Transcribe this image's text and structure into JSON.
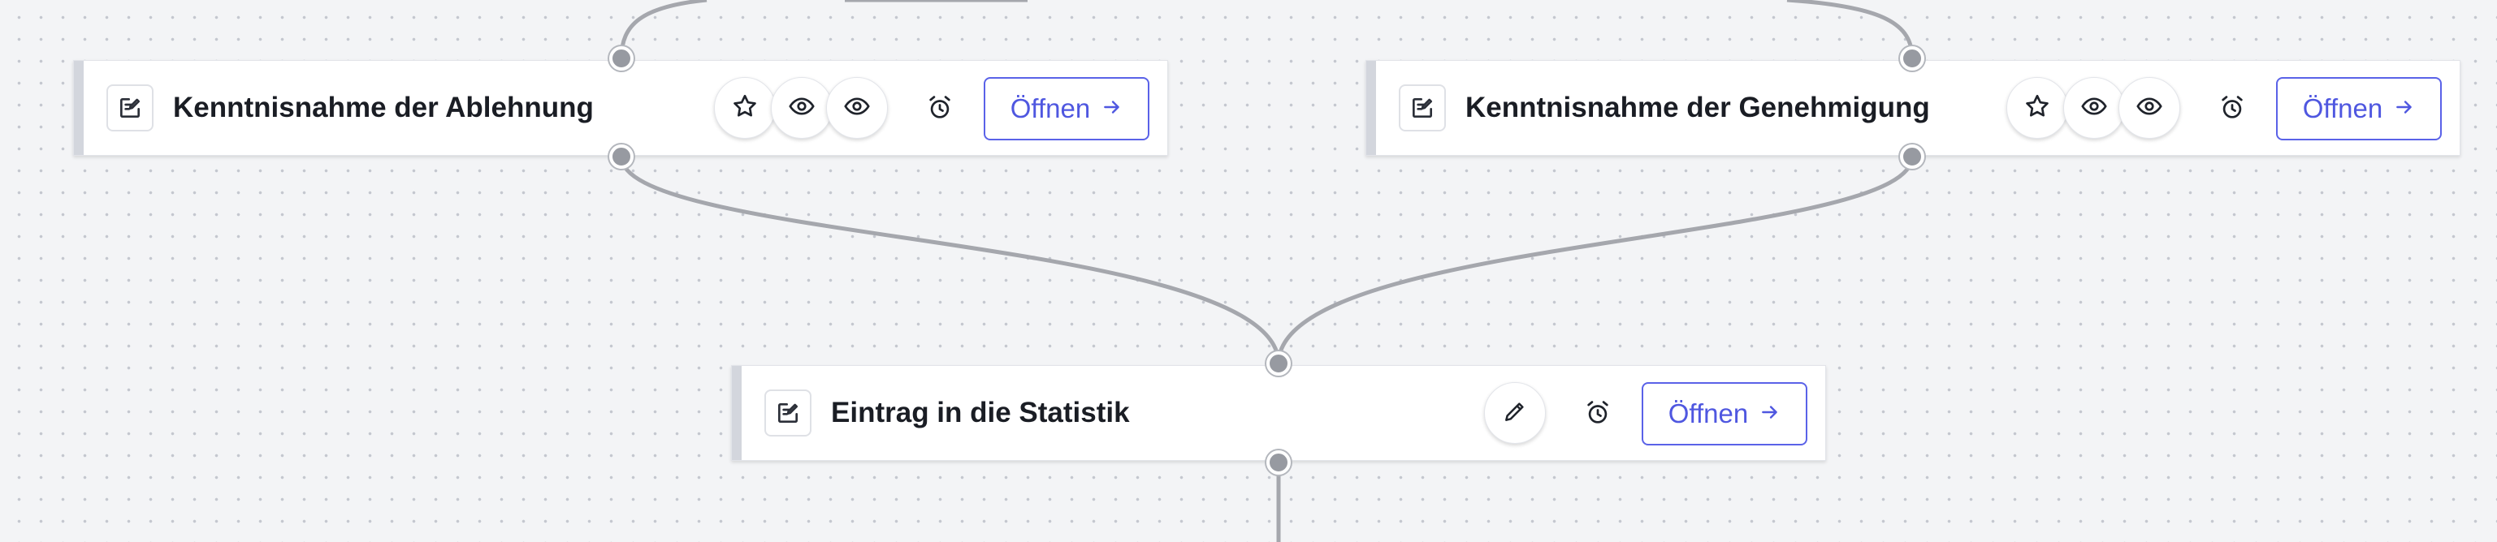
{
  "colors": {
    "accent": "#5a62e8",
    "edge": "#a5a7ad",
    "port": "#979aa1",
    "canvas": "#f3f4f6"
  },
  "nodes": [
    {
      "title": "Kenntnisnahme der Ablehnung",
      "type_icon": "task-edit-icon",
      "actions": [
        "star-icon",
        "eye-icon",
        "eye-icon",
        "alarm-clock-icon"
      ],
      "open_label": "Öffnen",
      "open_icon": "arrow-right-icon"
    },
    {
      "title": "Kenntnisnahme der Genehmigung",
      "type_icon": "task-edit-icon",
      "actions": [
        "star-icon",
        "eye-icon",
        "eye-icon",
        "alarm-clock-icon"
      ],
      "open_label": "Öffnen",
      "open_icon": "arrow-right-icon"
    },
    {
      "title": "Eintrag in die Statistik",
      "type_icon": "task-edit-icon",
      "actions": [
        "pencil-icon",
        "alarm-clock-icon"
      ],
      "open_label": "Öffnen",
      "open_icon": "arrow-right-icon"
    }
  ]
}
